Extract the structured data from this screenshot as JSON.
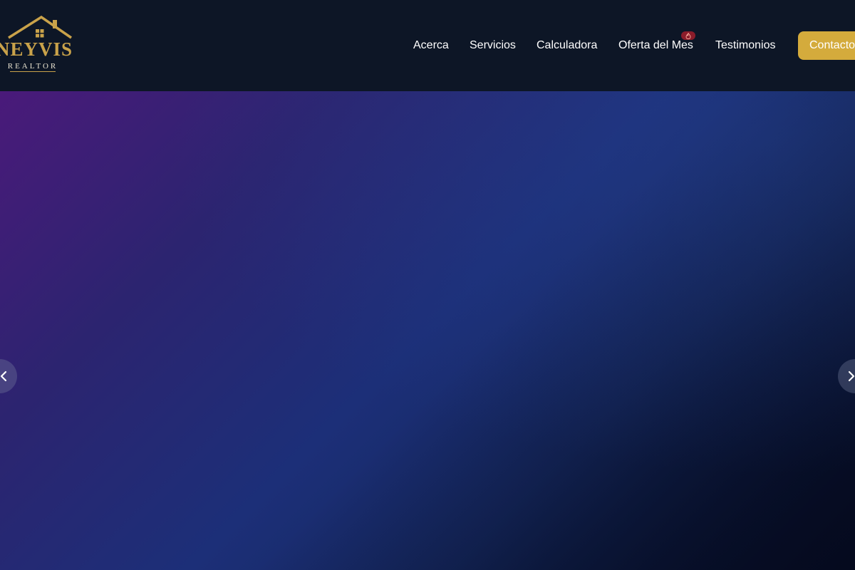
{
  "brand": {
    "name": "NEYVIS",
    "subtitle": "REALTOR",
    "accent_color": "#c9a24a"
  },
  "nav": {
    "items": [
      {
        "label": "Acerca"
      },
      {
        "label": "Servicios"
      },
      {
        "label": "Calculadora"
      },
      {
        "label": "Oferta del Mes"
      },
      {
        "label": "Testimonios"
      }
    ],
    "offer_badge_icon": "fire-icon",
    "contact_label": "Contacto",
    "contact_color": "#d4ab3c"
  },
  "hero": {
    "prev_icon": "chevron-left-icon",
    "next_icon": "chevron-right-icon"
  }
}
